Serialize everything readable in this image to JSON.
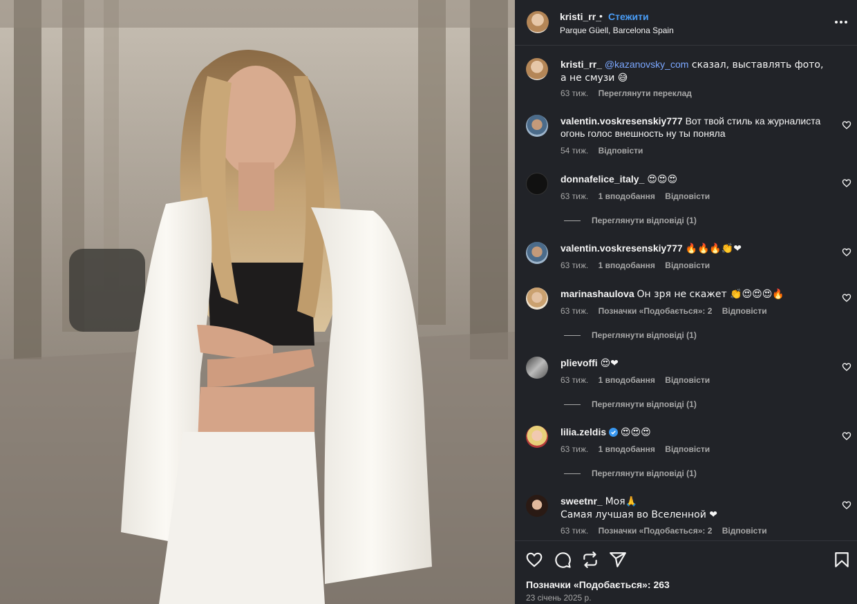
{
  "post": {
    "username": "kristi_rr_",
    "separator": "•",
    "follow_label": "Стежити",
    "location": "Parque Güell, Barcelona Spain",
    "more_icon": "more-horizontal-icon"
  },
  "caption": {
    "username": "kristi_rr_",
    "mention": "@kazanovsky_com",
    "text": " сказал, выставлять фото, а не смузи 😅",
    "time": "63 тиж.",
    "translate_label": "Переглянути переклад"
  },
  "comments": [
    {
      "username": "valentin.voskresenskiy777",
      "text": "Вот твой стиль ка журналиста огонь голос внешность ну ты поняла",
      "time": "54 тиж.",
      "likes": "",
      "reply": "Відповісти",
      "view_replies": ""
    },
    {
      "username": "donnafelice_italy_",
      "text": "😍😍😍",
      "time": "63 тиж.",
      "likes": "1 вподобання",
      "reply": "Відповісти",
      "view_replies": "Переглянути відповіді (1)"
    },
    {
      "username": "valentin.voskresenskiy777",
      "text": "🔥🔥🔥👏❤",
      "time": "63 тиж.",
      "likes": "1 вподобання",
      "reply": "Відповісти",
      "view_replies": ""
    },
    {
      "username": "marinashaulova",
      "text": "Он зря не скажет 👏😍😍😍🔥",
      "time": "63 тиж.",
      "likes": "Позначки «Подобається»: 2",
      "reply": "Відповісти",
      "view_replies": "Переглянути відповіді (1)"
    },
    {
      "username": "plievoffi",
      "text": "😍❤",
      "time": "63 тиж.",
      "likes": "1 вподобання",
      "reply": "Відповісти",
      "view_replies": "Переглянути відповіді (1)"
    },
    {
      "username": "lilia.zeldis",
      "text": "😍😍😍",
      "time": "63 тиж.",
      "likes": "1 вподобання",
      "reply": "Відповісти",
      "view_replies": "Переглянути відповіді (1)",
      "verified": true
    },
    {
      "username": "sweetnr_",
      "text": "Моя🙏",
      "text2": "Самая лучшая во Вселенной ❤",
      "time": "63 тиж.",
      "likes": "Позначки «Подобається»: 2",
      "reply": "Відповісти",
      "view_replies": ""
    }
  ],
  "footer": {
    "likes_label": "Позначки «Подобається»: 263",
    "date": "23 січень 2025 р."
  },
  "icons": {
    "like": "heart-icon",
    "comment": "comment-icon",
    "repost": "repost-icon",
    "share": "send-icon",
    "save": "bookmark-icon"
  },
  "colors": {
    "panel_bg": "#212328",
    "link": "#4a9ef8",
    "muted": "#a8a8a8",
    "verified": "#3897f0"
  }
}
